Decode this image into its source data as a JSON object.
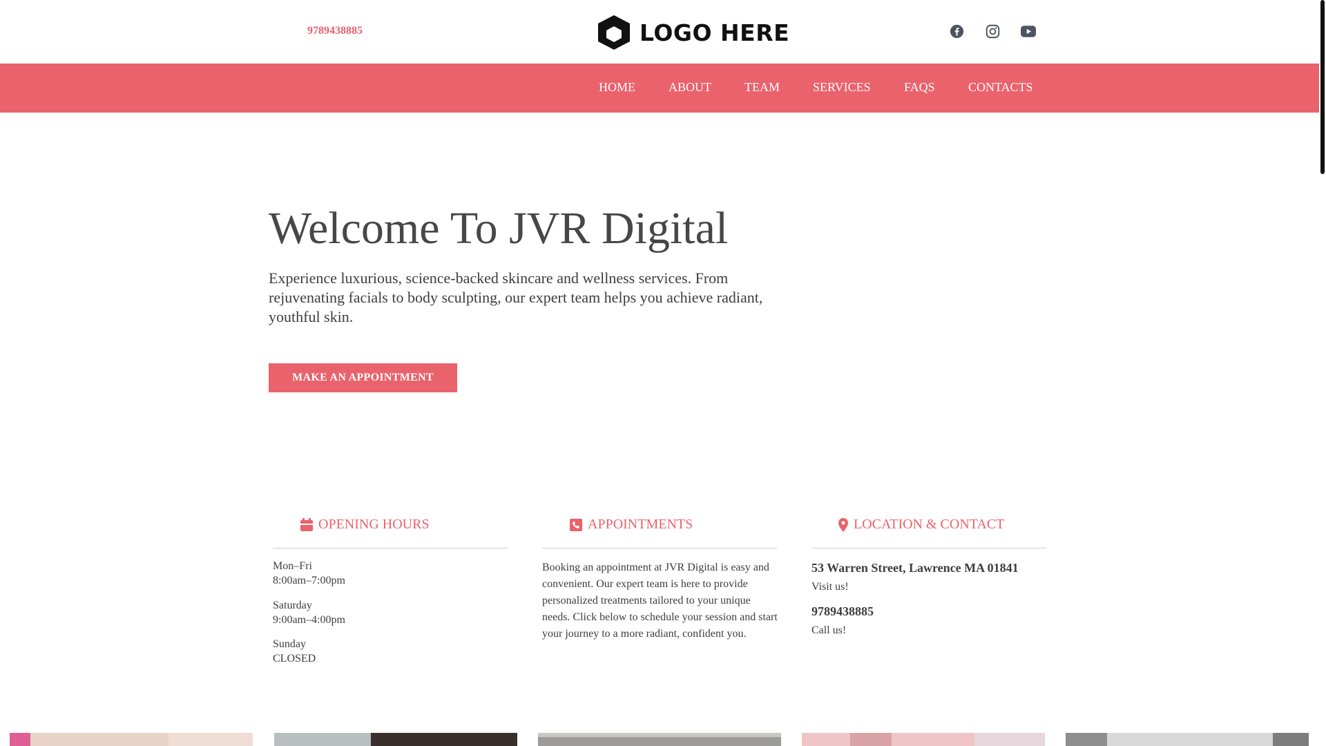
{
  "header": {
    "phone": "9789438885",
    "logo_text": "LOGO HERE",
    "social_icons": [
      "facebook-icon",
      "instagram-icon",
      "youtube-icon"
    ]
  },
  "nav": {
    "items": [
      {
        "label": "HOME"
      },
      {
        "label": "ABOUT"
      },
      {
        "label": "TEAM"
      },
      {
        "label": "SERVICES"
      },
      {
        "label": "FAQS"
      },
      {
        "label": "CONTACTS"
      }
    ]
  },
  "hero": {
    "title": "Welcome To JVR Digital",
    "text": "Experience luxurious, science-backed skincare and wellness services. From rejuvenating facials to body sculpting, our expert team helps you achieve radiant, youthful skin.",
    "cta": "MAKE AN APPOINTMENT"
  },
  "info": {
    "hours": {
      "heading": "OPENING HOURS",
      "icon": "calendar-icon",
      "rows": [
        {
          "day": "Mon–Fri",
          "time": "8:00am–7:00pm"
        },
        {
          "day": "Saturday",
          "time": "9:00am–4:00pm"
        },
        {
          "day": "Sunday",
          "time": "CLOSED"
        }
      ]
    },
    "appointments": {
      "heading": "APPOINTMENTS",
      "icon": "phone-icon",
      "text": "Booking an appointment at JVR Digital is easy and convenient. Our expert team is here to provide personalized treatments tailored to your unique needs. Click below to schedule your session and start your journey to a more radiant, confident you."
    },
    "location": {
      "heading": "LOCATION & CONTACT",
      "icon": "map-pin-icon",
      "address": "53 Warren Street, Lawrence MA 01841",
      "address_note": "Visit us!",
      "phone": "9789438885",
      "phone_note": "Call us!"
    }
  },
  "colors": {
    "accent": "#ea626c",
    "text": "#3d3d3d"
  }
}
